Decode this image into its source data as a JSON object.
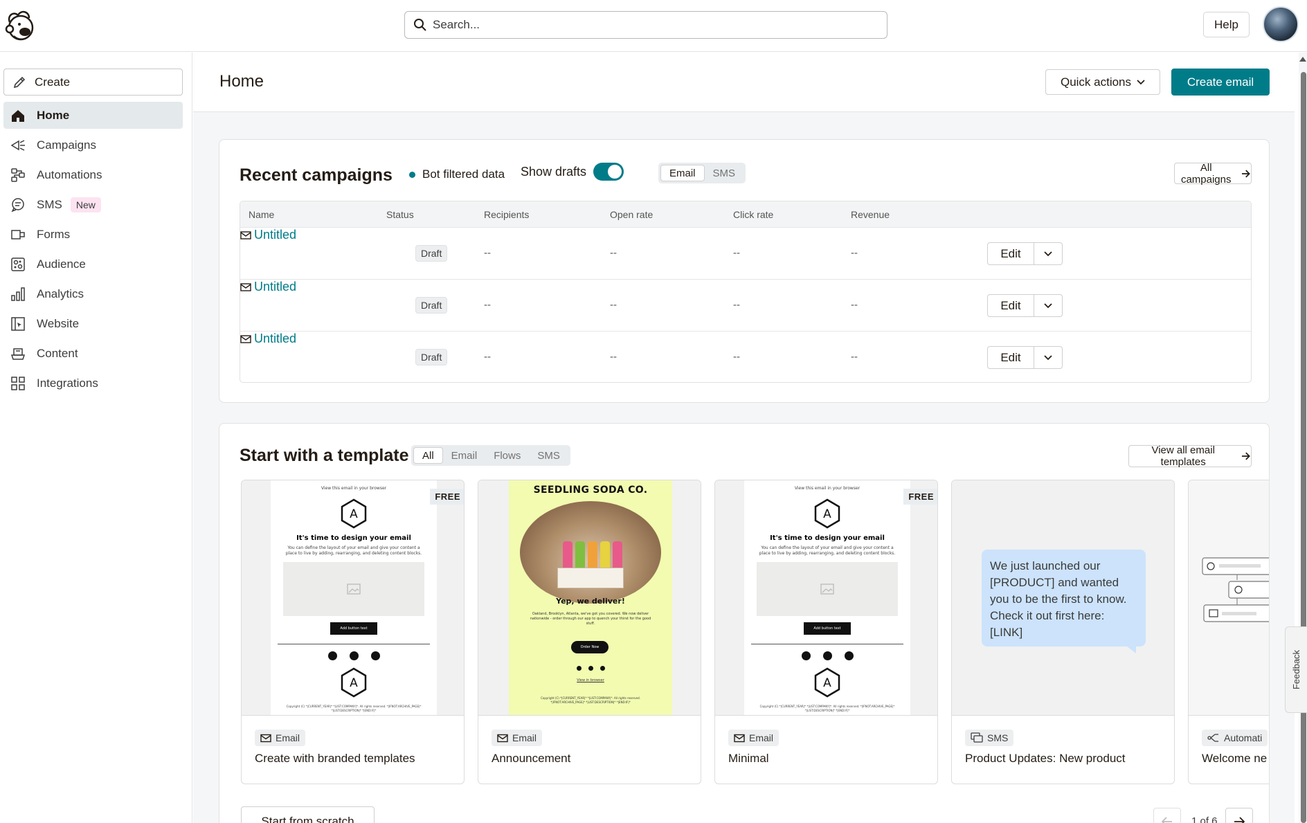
{
  "topbar": {
    "search_placeholder": "Search...",
    "help_label": "Help"
  },
  "sidebar": {
    "create_label": "Create",
    "items": [
      {
        "label": "Home",
        "icon": "home-icon",
        "active": true
      },
      {
        "label": "Campaigns",
        "icon": "megaphone-icon"
      },
      {
        "label": "Automations",
        "icon": "automation-icon"
      },
      {
        "label": "SMS",
        "icon": "sms-icon",
        "badge": "New"
      },
      {
        "label": "Forms",
        "icon": "forms-icon"
      },
      {
        "label": "Audience",
        "icon": "audience-icon"
      },
      {
        "label": "Analytics",
        "icon": "analytics-icon"
      },
      {
        "label": "Website",
        "icon": "website-icon"
      },
      {
        "label": "Content",
        "icon": "content-icon"
      },
      {
        "label": "Integrations",
        "icon": "integrations-icon"
      }
    ]
  },
  "header": {
    "title": "Home",
    "quick_actions_label": "Quick actions",
    "create_email_label": "Create email"
  },
  "recent": {
    "title": "Recent campaigns",
    "bot_filtered_label": "Bot filtered data",
    "show_drafts_label": "Show drafts",
    "show_drafts_on": true,
    "channel_tabs": [
      "Email",
      "SMS"
    ],
    "selected_channel": "Email",
    "all_campaigns_label": "All campaigns",
    "columns": [
      "Name",
      "Status",
      "Recipients",
      "Open rate",
      "Click rate",
      "Revenue"
    ],
    "rows": [
      {
        "name": "Untitled",
        "status": "Draft",
        "recipients": "--",
        "open_rate": "--",
        "click_rate": "--",
        "revenue": "--",
        "edit_label": "Edit"
      },
      {
        "name": "Untitled",
        "status": "Draft",
        "recipients": "--",
        "open_rate": "--",
        "click_rate": "--",
        "revenue": "--",
        "edit_label": "Edit"
      },
      {
        "name": "Untitled",
        "status": "Draft",
        "recipients": "--",
        "open_rate": "--",
        "click_rate": "--",
        "revenue": "--",
        "edit_label": "Edit"
      }
    ]
  },
  "templates": {
    "title": "Start with a template",
    "filter_tabs": [
      "All",
      "Email",
      "Flows",
      "SMS"
    ],
    "selected_filter": "All",
    "view_all_label": "View all email templates",
    "cards": [
      {
        "type_label": "Email",
        "name": "Create with branded templates",
        "free_label": "FREE",
        "preview": {
          "view_link": "View this email in your browser",
          "headline": "It's time to design your email",
          "body": "You can define the layout of your email and give your content a place to live by adding, rearranging, and deleting content blocks.",
          "button": "Add button text",
          "logo_letter": "A",
          "footer": "Copyright (C) *|CURRENT_YEAR|* *|LIST:COMPANY|*. All rights reserved. *|IFNOT:ARCHIVE_PAGE|* *|LIST:DESCRIPTION|* *|END:IF|*"
        }
      },
      {
        "type_label": "Email",
        "name": "Announcement",
        "preview": {
          "brand": "SEEDLING SODA CO.",
          "headline": "Yep, we deliver!",
          "body": "Oakland, Brooklyn, Atlanta, we've got you covered. We now deliver nationwide - order through our app to quench your thirst for the good stuff.",
          "button": "Order Now",
          "link": "View in browser",
          "footer": "Copyright (C) *|CURRENT_YEAR|* *|LIST:COMPANY|*. All rights reserved. *|IFNOT:ARCHIVE_PAGE|* *|LIST:DESCRIPTION|* *|END:IF|*"
        }
      },
      {
        "type_label": "Email",
        "name": "Minimal",
        "free_label": "FREE",
        "preview": {
          "view_link": "View this email in your browser",
          "headline": "It's time to design your email",
          "body": "You can define the layout of your email and give your content a place to live by adding, rearranging, and deleting content blocks.",
          "button": "Add button text",
          "logo_letter": "A",
          "footer": "Copyright (C) *|CURRENT_YEAR|* *|LIST:COMPANY|*. All rights reserved. *|IFNOT:ARCHIVE_PAGE|* *|LIST:DESCRIPTION|* *|END:IF|*"
        }
      },
      {
        "type_label": "SMS",
        "name": "Product Updates: New product",
        "preview": {
          "message": "We just launched our [PRODUCT] and wanted you to be the first to know. Check it out first here: [LINK]"
        }
      },
      {
        "type_label": "Automati",
        "name": "Welcome ne"
      }
    ],
    "start_scratch_label": "Start from scratch",
    "pagination": "1 of 6"
  },
  "feedback_label": "Feedback",
  "colors": {
    "accent": "#007c89",
    "active_nav": "#e4e9ec",
    "sms_bubble": "#cce3fb",
    "soda_bg": "#f2fbb0"
  }
}
